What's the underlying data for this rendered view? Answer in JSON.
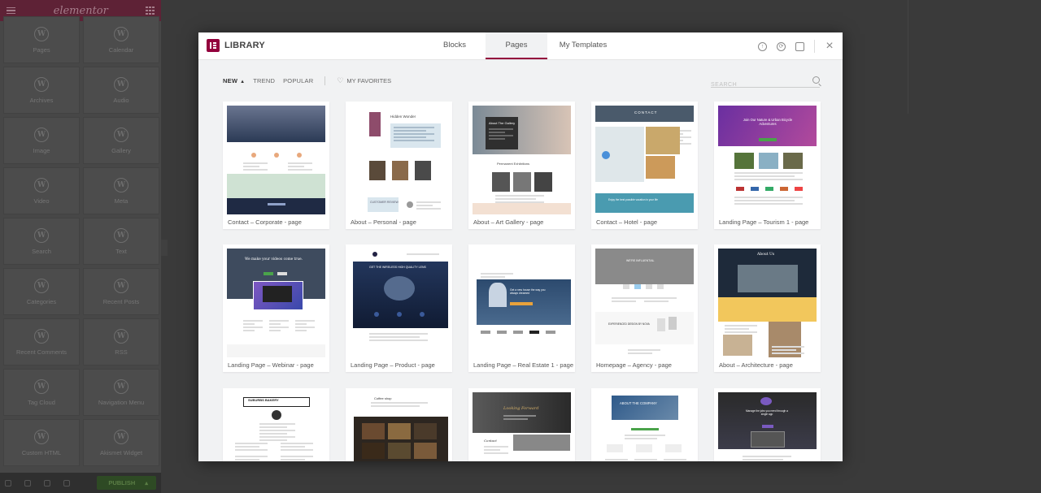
{
  "sidebar": {
    "logo_text": "elementor",
    "widgets": [
      {
        "label": "Pages",
        "icon": "wordpress-icon"
      },
      {
        "label": "Calendar",
        "icon": "wordpress-icon"
      },
      {
        "label": "Archives",
        "icon": "wordpress-icon"
      },
      {
        "label": "Audio",
        "icon": "wordpress-icon"
      },
      {
        "label": "Image",
        "icon": "wordpress-icon"
      },
      {
        "label": "Gallery",
        "icon": "wordpress-icon"
      },
      {
        "label": "Video",
        "icon": "wordpress-icon"
      },
      {
        "label": "Meta",
        "icon": "wordpress-icon"
      },
      {
        "label": "Search",
        "icon": "wordpress-icon"
      },
      {
        "label": "Text",
        "icon": "wordpress-icon"
      },
      {
        "label": "Categories",
        "icon": "wordpress-icon"
      },
      {
        "label": "Recent Posts",
        "icon": "wordpress-icon"
      },
      {
        "label": "Recent Comments",
        "icon": "wordpress-icon"
      },
      {
        "label": "RSS",
        "icon": "wordpress-icon"
      },
      {
        "label": "Tag Cloud",
        "icon": "wordpress-icon"
      },
      {
        "label": "Navigation Menu",
        "icon": "wordpress-icon"
      },
      {
        "label": "Custom HTML",
        "icon": "wordpress-icon"
      },
      {
        "label": "Akismet Widget",
        "icon": "wordpress-icon"
      }
    ],
    "publish_label": "PUBLISH"
  },
  "library": {
    "title": "LIBRARY",
    "brand_color": "#93003c",
    "tabs": [
      "Blocks",
      "Pages",
      "My Templates"
    ],
    "active_tab": "Pages",
    "filters": {
      "new": "NEW",
      "trend": "TREND",
      "popular": "POPULAR",
      "favorites": "MY FAVORITES"
    },
    "search_placeholder": "SEARCH"
  },
  "templates": [
    {
      "title": "Contact – Corporate - page",
      "preview": {
        "heading": "",
        "color": "#2b3a55"
      }
    },
    {
      "title": "About – Personal - page",
      "preview": {
        "heading": "Hidden Wonder",
        "color": "#d9e6ee",
        "button": "CUSTOMER REVIEW"
      }
    },
    {
      "title": "About – Art Gallery - page",
      "preview": {
        "heading": "About The Gallery",
        "color": "#3a3a3a",
        "subheading": "Permanent Exhibitions"
      }
    },
    {
      "title": "Contact – Hotel - page",
      "preview": {
        "heading": "CONTACT",
        "color": "#4a9bb0",
        "banner": "Enjoy the best possible vacation in your life"
      }
    },
    {
      "title": "Landing Page – Tourism 1 - page",
      "preview": {
        "heading": "Join Our Nature & Urban Bicycle Adventures",
        "color": "#7a3aa6"
      }
    },
    {
      "title": "Landing Page – Webinar - page",
      "preview": {
        "heading": "We make your videos come true.",
        "color": "#3e4b5e"
      }
    },
    {
      "title": "Landing Page – Product - page",
      "preview": {
        "heading": "GET THE WIRELESS HIGH QUALITY LENS",
        "color": "#1f2e4c"
      }
    },
    {
      "title": "Landing Page – Real Estate 1 - page",
      "preview": {
        "heading": "Get a new house the way you always dreamed",
        "color": "#2c4a6e"
      }
    },
    {
      "title": "Homepage – Agency - page",
      "preview": {
        "heading": "WE'RE INFLUENTIAL",
        "color": "#6b6b6b",
        "subheading": "EXPERIENCED DESIGN BY NOVA"
      }
    },
    {
      "title": "About – Architecture - page",
      "preview": {
        "heading": "About Us",
        "color": "#1e2a3a"
      }
    },
    {
      "title": "",
      "preview": {
        "heading": "SUBURBS BAKERY",
        "color": "#222222"
      }
    },
    {
      "title": "",
      "preview": {
        "heading": "Coffee shop",
        "color": "#2d2620"
      }
    },
    {
      "title": "",
      "preview": {
        "heading": "Looking Forward",
        "color": "#3a3a3a",
        "subheading": "Contact"
      }
    },
    {
      "title": "",
      "preview": {
        "heading": "ABOUT THE COMPANY",
        "color": "#2f5a8a"
      }
    },
    {
      "title": "",
      "preview": {
        "heading": "Manage the jobs you need through a single app",
        "color": "#2a2a2a"
      }
    }
  ]
}
